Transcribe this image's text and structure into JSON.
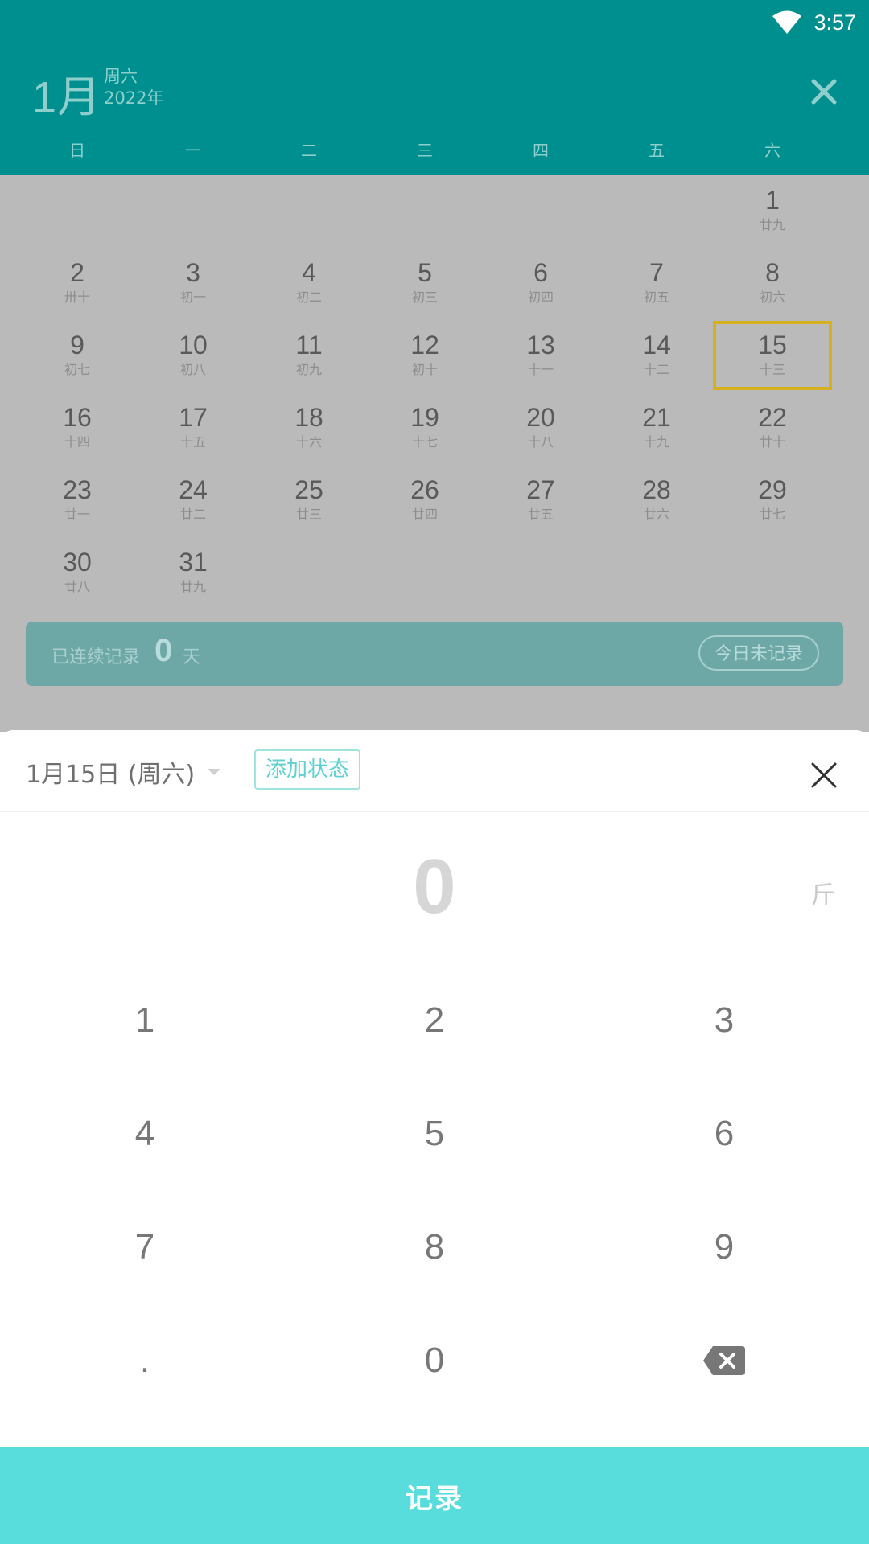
{
  "status_bar": {
    "time": "3:57",
    "wifi_icon": "wifi-icon"
  },
  "header": {
    "month": "1月",
    "weekday": "周六",
    "year": "2022年",
    "close_icon": "close-icon",
    "weekdays": [
      "日",
      "一",
      "二",
      "三",
      "四",
      "五",
      "六"
    ]
  },
  "calendar": {
    "days": [
      {
        "num": "",
        "lunar": ""
      },
      {
        "num": "",
        "lunar": ""
      },
      {
        "num": "",
        "lunar": ""
      },
      {
        "num": "",
        "lunar": ""
      },
      {
        "num": "",
        "lunar": ""
      },
      {
        "num": "",
        "lunar": ""
      },
      {
        "num": "1",
        "lunar": "廿九"
      },
      {
        "num": "2",
        "lunar": "卅十"
      },
      {
        "num": "3",
        "lunar": "初一"
      },
      {
        "num": "4",
        "lunar": "初二"
      },
      {
        "num": "5",
        "lunar": "初三"
      },
      {
        "num": "6",
        "lunar": "初四"
      },
      {
        "num": "7",
        "lunar": "初五"
      },
      {
        "num": "8",
        "lunar": "初六"
      },
      {
        "num": "9",
        "lunar": "初七"
      },
      {
        "num": "10",
        "lunar": "初八"
      },
      {
        "num": "11",
        "lunar": "初九"
      },
      {
        "num": "12",
        "lunar": "初十"
      },
      {
        "num": "13",
        "lunar": "十一"
      },
      {
        "num": "14",
        "lunar": "十二"
      },
      {
        "num": "15",
        "lunar": "十三",
        "selected": true
      },
      {
        "num": "16",
        "lunar": "十四"
      },
      {
        "num": "17",
        "lunar": "十五"
      },
      {
        "num": "18",
        "lunar": "十六"
      },
      {
        "num": "19",
        "lunar": "十七"
      },
      {
        "num": "20",
        "lunar": "十八"
      },
      {
        "num": "21",
        "lunar": "十九"
      },
      {
        "num": "22",
        "lunar": "廿十"
      },
      {
        "num": "23",
        "lunar": "廿一"
      },
      {
        "num": "24",
        "lunar": "廿二"
      },
      {
        "num": "25",
        "lunar": "廿三"
      },
      {
        "num": "26",
        "lunar": "廿四"
      },
      {
        "num": "27",
        "lunar": "廿五"
      },
      {
        "num": "28",
        "lunar": "廿六"
      },
      {
        "num": "29",
        "lunar": "廿七"
      },
      {
        "num": "30",
        "lunar": "廿八"
      },
      {
        "num": "31",
        "lunar": "廿九"
      }
    ],
    "selected_color": "#d6b11f"
  },
  "streak": {
    "label": "已连续记录",
    "count": "0",
    "unit": "天",
    "today_status": "今日未记录"
  },
  "sheet": {
    "date_label": "1月15日 (周六)",
    "add_status_label": "添加状态",
    "close_icon": "close-icon",
    "value": "0",
    "unit": "斤",
    "keys": [
      [
        "1",
        "2",
        "3"
      ],
      [
        "4",
        "5",
        "6"
      ],
      [
        "7",
        "8",
        "9"
      ],
      [
        ".",
        "0",
        ""
      ]
    ],
    "backspace_icon": "backspace-icon",
    "record_label": "记录",
    "accent_color": "#59dcdc"
  },
  "colors": {
    "header_bg": "#008f8f",
    "overlay": "#bababa"
  }
}
